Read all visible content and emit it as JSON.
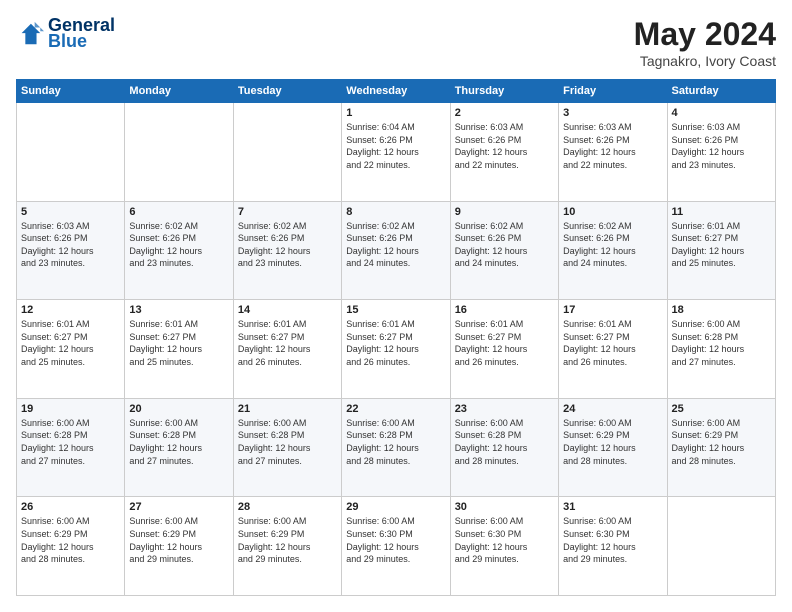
{
  "header": {
    "logo_line1": "General",
    "logo_line2": "Blue",
    "title": "May 2024",
    "subtitle": "Tagnakro, Ivory Coast"
  },
  "days_of_week": [
    "Sunday",
    "Monday",
    "Tuesday",
    "Wednesday",
    "Thursday",
    "Friday",
    "Saturday"
  ],
  "weeks": [
    [
      {
        "day": "",
        "info": ""
      },
      {
        "day": "",
        "info": ""
      },
      {
        "day": "",
        "info": ""
      },
      {
        "day": "1",
        "info": "Sunrise: 6:04 AM\nSunset: 6:26 PM\nDaylight: 12 hours\nand 22 minutes."
      },
      {
        "day": "2",
        "info": "Sunrise: 6:03 AM\nSunset: 6:26 PM\nDaylight: 12 hours\nand 22 minutes."
      },
      {
        "day": "3",
        "info": "Sunrise: 6:03 AM\nSunset: 6:26 PM\nDaylight: 12 hours\nand 22 minutes."
      },
      {
        "day": "4",
        "info": "Sunrise: 6:03 AM\nSunset: 6:26 PM\nDaylight: 12 hours\nand 23 minutes."
      }
    ],
    [
      {
        "day": "5",
        "info": "Sunrise: 6:03 AM\nSunset: 6:26 PM\nDaylight: 12 hours\nand 23 minutes."
      },
      {
        "day": "6",
        "info": "Sunrise: 6:02 AM\nSunset: 6:26 PM\nDaylight: 12 hours\nand 23 minutes."
      },
      {
        "day": "7",
        "info": "Sunrise: 6:02 AM\nSunset: 6:26 PM\nDaylight: 12 hours\nand 23 minutes."
      },
      {
        "day": "8",
        "info": "Sunrise: 6:02 AM\nSunset: 6:26 PM\nDaylight: 12 hours\nand 24 minutes."
      },
      {
        "day": "9",
        "info": "Sunrise: 6:02 AM\nSunset: 6:26 PM\nDaylight: 12 hours\nand 24 minutes."
      },
      {
        "day": "10",
        "info": "Sunrise: 6:02 AM\nSunset: 6:26 PM\nDaylight: 12 hours\nand 24 minutes."
      },
      {
        "day": "11",
        "info": "Sunrise: 6:01 AM\nSunset: 6:27 PM\nDaylight: 12 hours\nand 25 minutes."
      }
    ],
    [
      {
        "day": "12",
        "info": "Sunrise: 6:01 AM\nSunset: 6:27 PM\nDaylight: 12 hours\nand 25 minutes."
      },
      {
        "day": "13",
        "info": "Sunrise: 6:01 AM\nSunset: 6:27 PM\nDaylight: 12 hours\nand 25 minutes."
      },
      {
        "day": "14",
        "info": "Sunrise: 6:01 AM\nSunset: 6:27 PM\nDaylight: 12 hours\nand 26 minutes."
      },
      {
        "day": "15",
        "info": "Sunrise: 6:01 AM\nSunset: 6:27 PM\nDaylight: 12 hours\nand 26 minutes."
      },
      {
        "day": "16",
        "info": "Sunrise: 6:01 AM\nSunset: 6:27 PM\nDaylight: 12 hours\nand 26 minutes."
      },
      {
        "day": "17",
        "info": "Sunrise: 6:01 AM\nSunset: 6:27 PM\nDaylight: 12 hours\nand 26 minutes."
      },
      {
        "day": "18",
        "info": "Sunrise: 6:00 AM\nSunset: 6:28 PM\nDaylight: 12 hours\nand 27 minutes."
      }
    ],
    [
      {
        "day": "19",
        "info": "Sunrise: 6:00 AM\nSunset: 6:28 PM\nDaylight: 12 hours\nand 27 minutes."
      },
      {
        "day": "20",
        "info": "Sunrise: 6:00 AM\nSunset: 6:28 PM\nDaylight: 12 hours\nand 27 minutes."
      },
      {
        "day": "21",
        "info": "Sunrise: 6:00 AM\nSunset: 6:28 PM\nDaylight: 12 hours\nand 27 minutes."
      },
      {
        "day": "22",
        "info": "Sunrise: 6:00 AM\nSunset: 6:28 PM\nDaylight: 12 hours\nand 28 minutes."
      },
      {
        "day": "23",
        "info": "Sunrise: 6:00 AM\nSunset: 6:28 PM\nDaylight: 12 hours\nand 28 minutes."
      },
      {
        "day": "24",
        "info": "Sunrise: 6:00 AM\nSunset: 6:29 PM\nDaylight: 12 hours\nand 28 minutes."
      },
      {
        "day": "25",
        "info": "Sunrise: 6:00 AM\nSunset: 6:29 PM\nDaylight: 12 hours\nand 28 minutes."
      }
    ],
    [
      {
        "day": "26",
        "info": "Sunrise: 6:00 AM\nSunset: 6:29 PM\nDaylight: 12 hours\nand 28 minutes."
      },
      {
        "day": "27",
        "info": "Sunrise: 6:00 AM\nSunset: 6:29 PM\nDaylight: 12 hours\nand 29 minutes."
      },
      {
        "day": "28",
        "info": "Sunrise: 6:00 AM\nSunset: 6:29 PM\nDaylight: 12 hours\nand 29 minutes."
      },
      {
        "day": "29",
        "info": "Sunrise: 6:00 AM\nSunset: 6:30 PM\nDaylight: 12 hours\nand 29 minutes."
      },
      {
        "day": "30",
        "info": "Sunrise: 6:00 AM\nSunset: 6:30 PM\nDaylight: 12 hours\nand 29 minutes."
      },
      {
        "day": "31",
        "info": "Sunrise: 6:00 AM\nSunset: 6:30 PM\nDaylight: 12 hours\nand 29 minutes."
      },
      {
        "day": "",
        "info": ""
      }
    ]
  ]
}
